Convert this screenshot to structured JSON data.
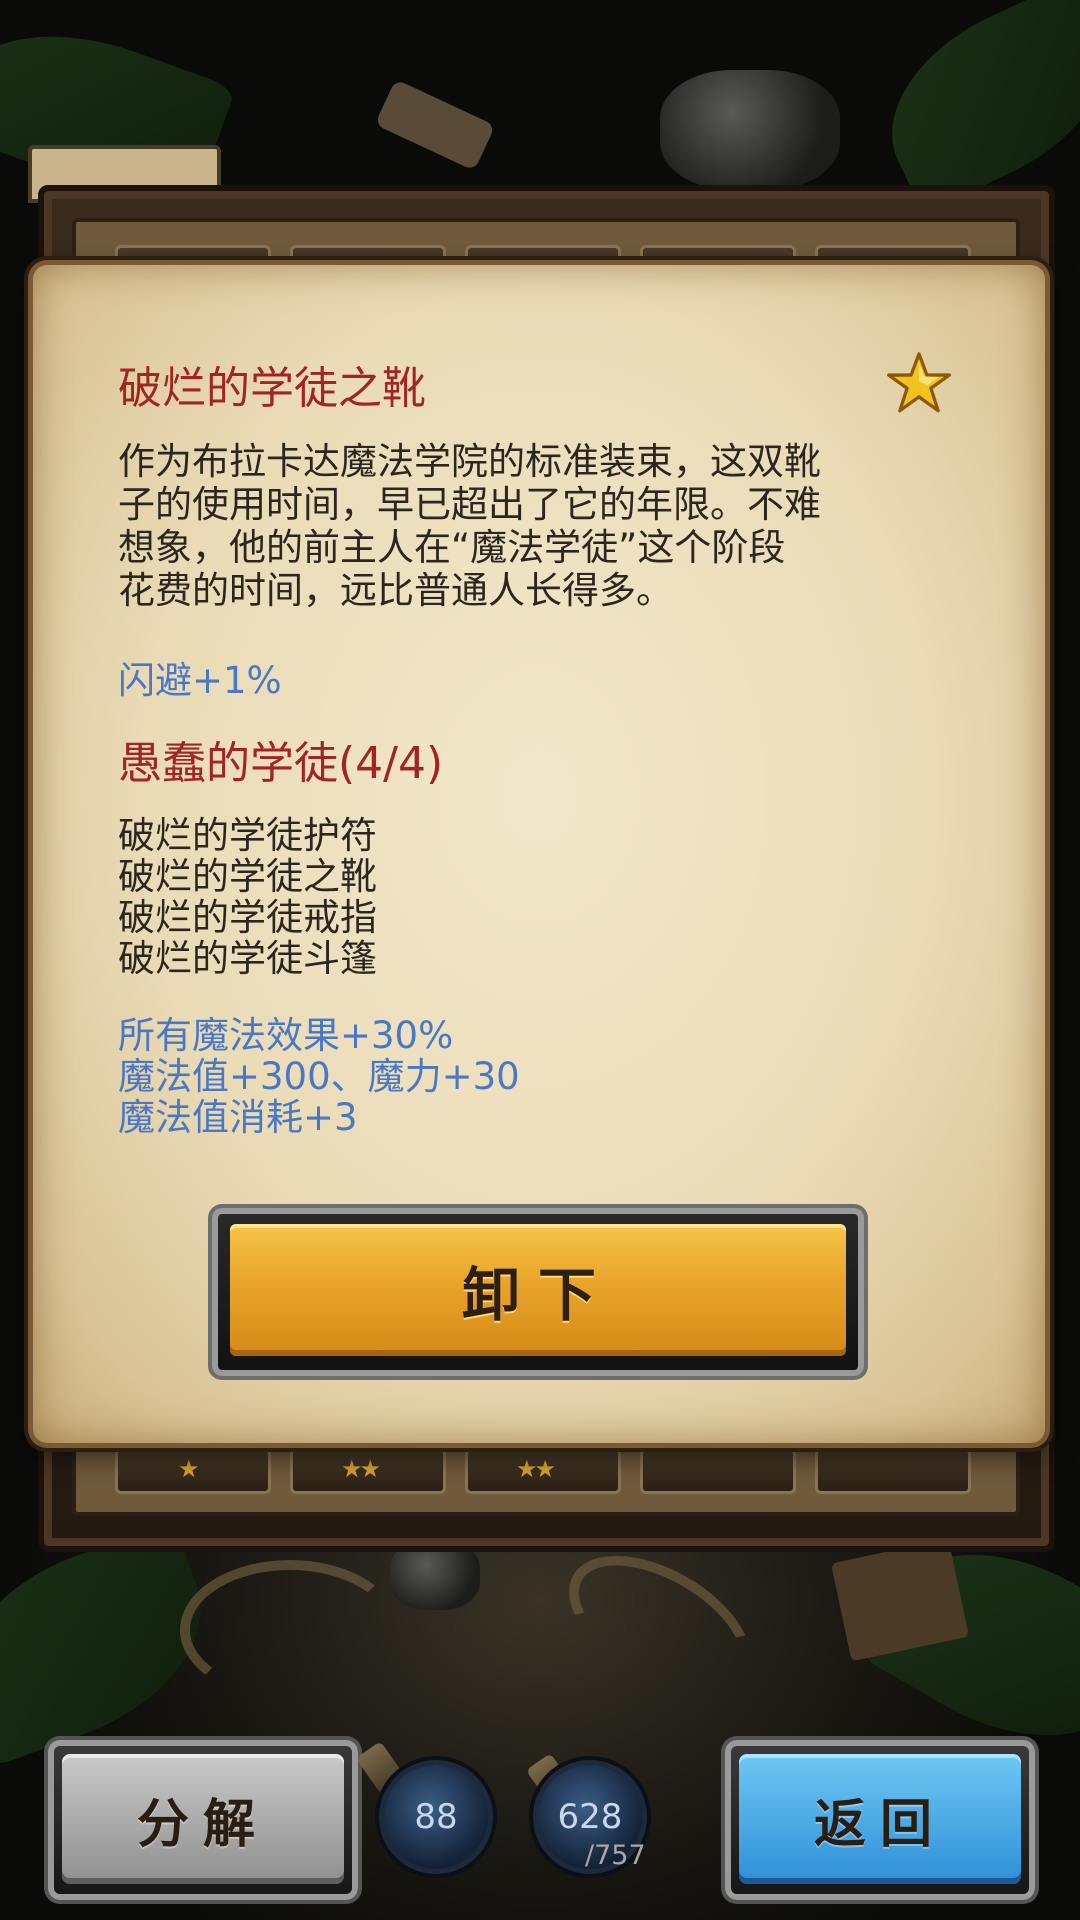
{
  "item": {
    "name": "破烂的学徒之靴",
    "rarity_icon": "gold-star-icon",
    "description_lines": [
      "作为布拉卡达魔法学院的标准装束，这双靴",
      "子的使用时间，早已超出了它的年限。不难",
      "想象，他的前主人在“魔法学徒”这个阶段",
      "花费的时间，远比普通人长得多。"
    ],
    "bonus": "闪避+1%"
  },
  "set": {
    "title": "愚蠢的学徒(4/4)",
    "items": [
      "破烂的学徒护符",
      "破烂的学徒之靴",
      "破烂的学徒戒指",
      "破烂的学徒斗篷"
    ],
    "bonuses": [
      "所有魔法效果+30%",
      "魔法值+300、魔力+30",
      "魔法值消耗+3"
    ]
  },
  "buttons": {
    "unequip": "卸下",
    "disassemble": "分解",
    "back": "返回"
  },
  "resources": {
    "orb_left_value": "88",
    "orb_right_value": "628",
    "orb_right_max": "/757"
  },
  "slots_bottom_stars": [
    "★",
    "★★",
    "★★",
    "",
    ""
  ],
  "colors": {
    "title_red": "#a12522",
    "stat_blue": "#4a78c4",
    "button_gold": "#e9a42a",
    "button_blue": "#2e8fd6",
    "button_gray": "#8f8f8f"
  }
}
